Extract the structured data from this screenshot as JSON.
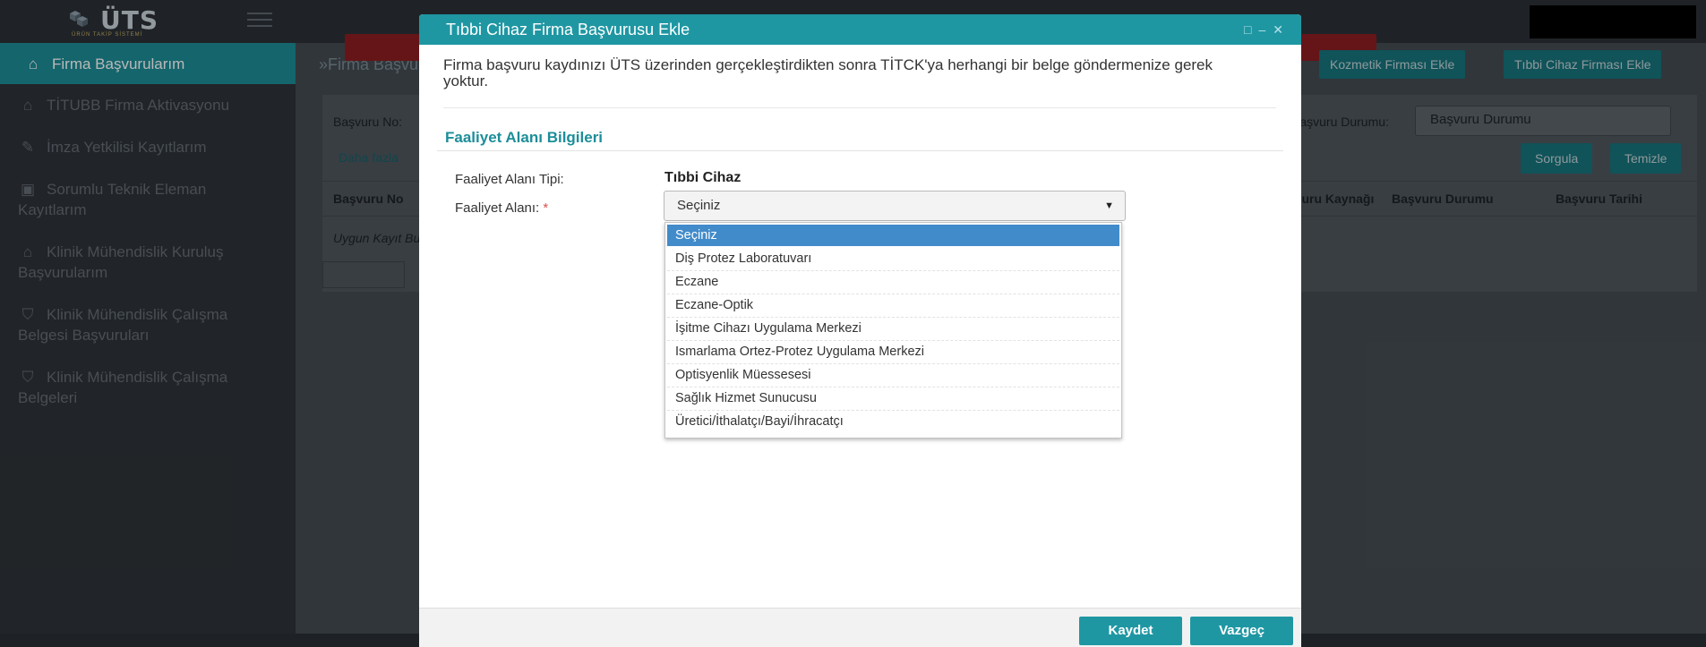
{
  "logo": {
    "name": "ÜTS",
    "subtitle": "ÜRÜN TAKİP SİSTEMİ"
  },
  "sidebar": {
    "items": [
      {
        "icon": "home-icon",
        "label": "Firma Başvurularım",
        "active": true
      },
      {
        "icon": "home-icon",
        "label": "TİTUBB Firma Aktivasyonu"
      },
      {
        "icon": "edit-icon",
        "label": "İmza Yetkilisi Kayıtlarım"
      },
      {
        "icon": "briefcase-icon",
        "label": "Sorumlu Teknik Eleman Kayıtlarım"
      },
      {
        "icon": "home-icon",
        "label": "Klinik Mühendislik Kuruluş Başvurularım"
      },
      {
        "icon": "shield-icon",
        "label": "Klinik Mühendislik Çalışma Belgesi Başvuruları"
      },
      {
        "icon": "shield-icon",
        "label": "Klinik Mühendislik Çalışma Belgeleri"
      }
    ]
  },
  "background": {
    "breadcrumb": "»Firma Başvurularım",
    "buttons": {
      "kozmetik": "Kozmetik Firması Ekle",
      "tibbi": "Tıbbi Cihaz Firması Ekle",
      "sorgula": "Sorgula",
      "temizle": "Temizle"
    },
    "labels": {
      "basvuru_no": "Başvuru No:",
      "daha_fazla": "Daha fazla",
      "basvuru_durumu_lbl": "Başvuru Durumu:",
      "no_record": "Uygun Kayıt Bulunamadı"
    },
    "durum_select": "Başvuru Durumu",
    "columns": [
      "Başvuru No",
      "Başvuru Kaynağı",
      "Başvuru Durumu",
      "Başvuru Tarihi"
    ]
  },
  "modal": {
    "title": "Tıbbi Cihaz Firma Başvurusu Ekle",
    "intro": "Firma başvuru kaydınızı ÜTS üzerinden gerçekleştirdikten sonra TİTCK'ya herhangi bir belge göndermenize gerek yoktur.",
    "section_title": "Faaliyet Alanı Bilgileri",
    "tip_label": "Faaliyet Alanı Tipi:",
    "tip_value": "Tıbbi Cihaz",
    "alan_label": "Faaliyet Alanı:",
    "required_mark": "*",
    "select_value": "Seçiniz",
    "options": [
      "Seçiniz",
      "Diş Protez Laboratuvarı",
      "Eczane",
      "Eczane-Optik",
      "İşitme Cihazı Uygulama Merkezi",
      "Ismarlama Ortez-Protez Uygulama Merkezi",
      "Optisyenlik Müessesesi",
      "Sağlık Hizmet Sunucusu",
      "Üretici/İthalatçı/Bayi/İhracatçı"
    ],
    "save_label": "Kaydet",
    "cancel_label": "Vazgeç"
  },
  "colors": {
    "accent": "#1f97a3",
    "selected_option": "#428bca",
    "required": "#d9534f"
  }
}
